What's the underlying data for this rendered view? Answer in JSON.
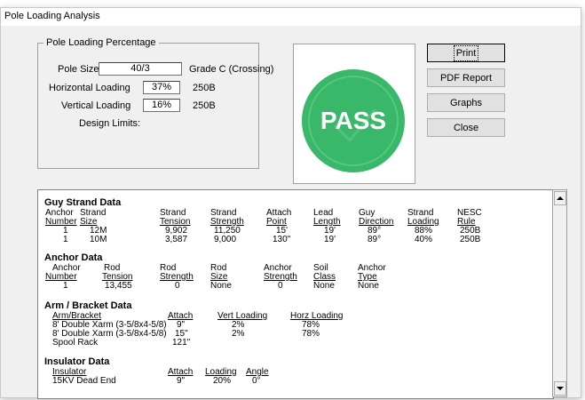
{
  "window": {
    "title": "Pole Loading Analysis"
  },
  "loading_group": {
    "legend": "Pole Loading Percentage",
    "pole_size_label": "Pole Size",
    "pole_size_value": "40/3",
    "pole_grade": "Grade C (Crossing)",
    "horizontal_label": "Horizontal Loading",
    "horizontal_value": "37%",
    "horizontal_rule": "250B",
    "vertical_label": "Vertical Loading",
    "vertical_value": "16%",
    "vertical_rule": "250B",
    "design_limits_label": "Design Limits:"
  },
  "result": {
    "text": "PASS",
    "color": "#3ab86a",
    "ring_color": "#5fca87"
  },
  "buttons": {
    "print": "Print",
    "pdf": "PDF Report",
    "graphs": "Graphs",
    "close": "Close"
  },
  "report": {
    "guy": {
      "title": "Guy Strand Data",
      "head1": [
        "Anchor",
        "Strand",
        "Strand",
        "Strand",
        "Attach",
        "Lead",
        "Guy",
        "Strand",
        "NESC"
      ],
      "head2": [
        "Number",
        "Size",
        "Tension",
        "Strength",
        "Point",
        "Length",
        "Direction",
        "Loading",
        "Rule"
      ],
      "rows": [
        [
          "1",
          "12M",
          "9,902",
          "11,250",
          "15'",
          "19'",
          "89°",
          "88%",
          "250B"
        ],
        [
          "1",
          "10M",
          "3,587",
          "9,000",
          "130\"",
          "19'",
          "89°",
          "40%",
          "250B"
        ]
      ]
    },
    "anchor": {
      "title": "Anchor Data",
      "head1": [
        "Anchor",
        "Rod",
        "Rod",
        "Rod",
        "Anchor",
        "Soil",
        "Anchor"
      ],
      "head2": [
        "Number",
        "Tension",
        "Strength",
        "Size",
        "Strength",
        "Class",
        "Type"
      ],
      "rows": [
        [
          "1",
          "13,455",
          "0",
          "None",
          "0",
          "None",
          "None"
        ]
      ]
    },
    "arm": {
      "title": "Arm / Bracket Data",
      "head": [
        "Arm/Bracket",
        "Attach",
        "Vert Loading",
        "Horz Loading"
      ],
      "rows": [
        [
          "8' Double Xarm (3-5/8x4-5/8)",
          "9\"",
          "2%",
          "78%"
        ],
        [
          "8' Double Xarm (3-5/8x4-5/8)",
          "15\"",
          "2%",
          "78%"
        ],
        [
          "Spool Rack",
          "121\"",
          "",
          ""
        ]
      ]
    },
    "insulator": {
      "title": "Insulator Data",
      "head": [
        "Insulator",
        "Attach",
        "Loading",
        "Angle"
      ],
      "rows": [
        [
          "15KV Dead End",
          "9\"",
          "20%",
          "0°"
        ]
      ]
    }
  }
}
